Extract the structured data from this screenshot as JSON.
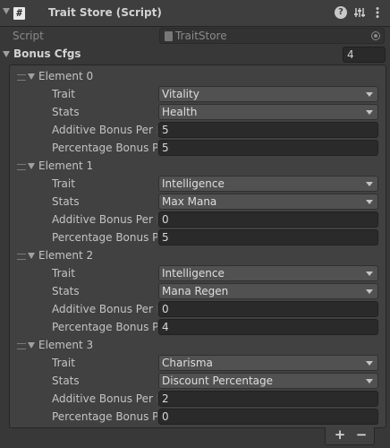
{
  "component": {
    "title": "Trait Store (Script)",
    "icon_glyph": "#",
    "help_glyph": "?",
    "icons": [
      "hash-script-icon",
      "help-icon",
      "preset-icon",
      "more-icon"
    ]
  },
  "script_field": {
    "label": "Script",
    "value": "TraitStore"
  },
  "list": {
    "title": "Bonus Cfgs",
    "count": "4",
    "elements": [
      {
        "label": "Element 0",
        "trait_label": "Trait",
        "trait": "Vitality",
        "stats_label": "Stats",
        "stats": "Health",
        "additive_label": "Additive Bonus Per Point",
        "additive": "5",
        "percentage_label": "Percentage Bonus Per Point",
        "percentage": "5"
      },
      {
        "label": "Element 1",
        "trait_label": "Trait",
        "trait": "Intelligence",
        "stats_label": "Stats",
        "stats": "Max Mana",
        "additive_label": "Additive Bonus Per Point",
        "additive": "0",
        "percentage_label": "Percentage Bonus Per Point",
        "percentage": "5"
      },
      {
        "label": "Element 2",
        "trait_label": "Trait",
        "trait": "Intelligence",
        "stats_label": "Stats",
        "stats": "Mana Regen",
        "additive_label": "Additive Bonus Per Point",
        "additive": "0",
        "percentage_label": "Percentage Bonus Per Point",
        "percentage": "4"
      },
      {
        "label": "Element 3",
        "trait_label": "Trait",
        "trait": "Charisma",
        "stats_label": "Stats",
        "stats": "Discount Percentage",
        "additive_label": "Additive Bonus Per Point",
        "additive": "2",
        "percentage_label": "Percentage Bonus Per Point",
        "percentage": "0"
      }
    ]
  },
  "footer": {
    "add_label": "+",
    "remove_label": "−"
  },
  "colors": {
    "background": "#383838",
    "header": "#3e3e3e",
    "field": "#2a2a2a",
    "dropdown": "#515151",
    "text": "#c4c4c4"
  }
}
